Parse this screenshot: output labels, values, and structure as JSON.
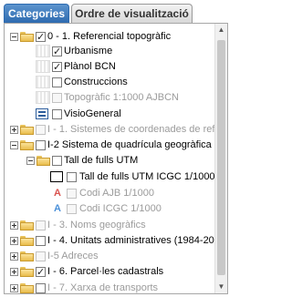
{
  "tabs": {
    "categories": "Categories",
    "order": "Ordre de visualització"
  },
  "tree": {
    "n0": "0 - 1. Referencial topogràfic",
    "n1": "Urbanisme",
    "n2": "Plànol BCN",
    "n3": "Construccions",
    "n4": "Topogràfic 1:1000 AJBCN",
    "n5": "VisioGeneral",
    "n6": "I - 1. Sistemes de coordenades de refe",
    "n7": "I-2 Sistema de quadrícula geogràfica",
    "n8": "Tall de fulls UTM",
    "n9": "Tall de fulls UTM ICGC 1/1000",
    "n10": "Codi AJB 1/1000",
    "n11": "Codi ICGC 1/1000",
    "n12": "I - 3. Noms geogràfics",
    "n13": "I - 4. Unitats administratives (1984-201",
    "n14": "I-5 Adreces",
    "n15": "I - 6. Parcel·les cadastrals",
    "n16": "I - 7. Xarxa de transports"
  },
  "icons": {
    "letter_a1": "A",
    "letter_a2": "A"
  },
  "colors": {
    "tab_active": "#2e6bb0",
    "letter_red": "#d9534f",
    "letter_blue": "#4a90d9"
  }
}
